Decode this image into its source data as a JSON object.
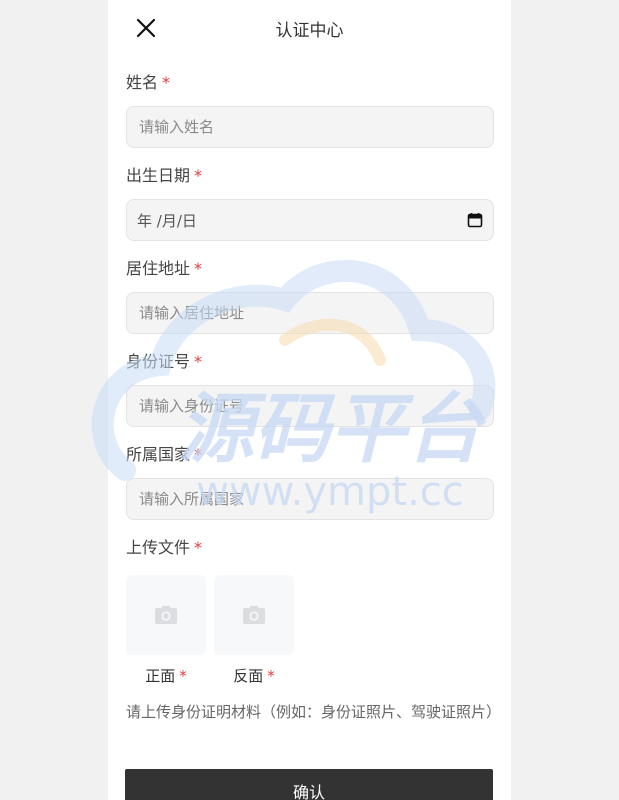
{
  "header": {
    "title": "认证中心",
    "close_icon": "close-icon"
  },
  "form": {
    "name": {
      "label": "姓名",
      "required": "*",
      "placeholder": "请输入姓名"
    },
    "birth": {
      "label": "出生日期",
      "required": "*",
      "value": "年 /月/日",
      "icon": "calendar-icon"
    },
    "address": {
      "label": "居住地址",
      "required": "*",
      "placeholder": "请输入居住地址"
    },
    "id_number": {
      "label": "身份证号",
      "required": "*",
      "placeholder": "请输入身份证号"
    },
    "country": {
      "label": "所属国家",
      "required": "*",
      "placeholder": "请输入所属国家"
    },
    "upload": {
      "label": "上传文件",
      "required": "*",
      "front": {
        "caption": "正面",
        "required": "*",
        "icon": "camera-icon"
      },
      "back": {
        "caption": "反面",
        "required": "*",
        "icon": "camera-icon"
      },
      "hint": "请上传身份证明材料（例如：身份证照片、驾驶证照片）"
    }
  },
  "confirm_label": "确认",
  "watermark": {
    "text": "源码平台",
    "url": "www.ympt.cc"
  },
  "colors": {
    "required": "#e23a3a",
    "button": "#333333",
    "input_bg": "#f4f4f4"
  }
}
